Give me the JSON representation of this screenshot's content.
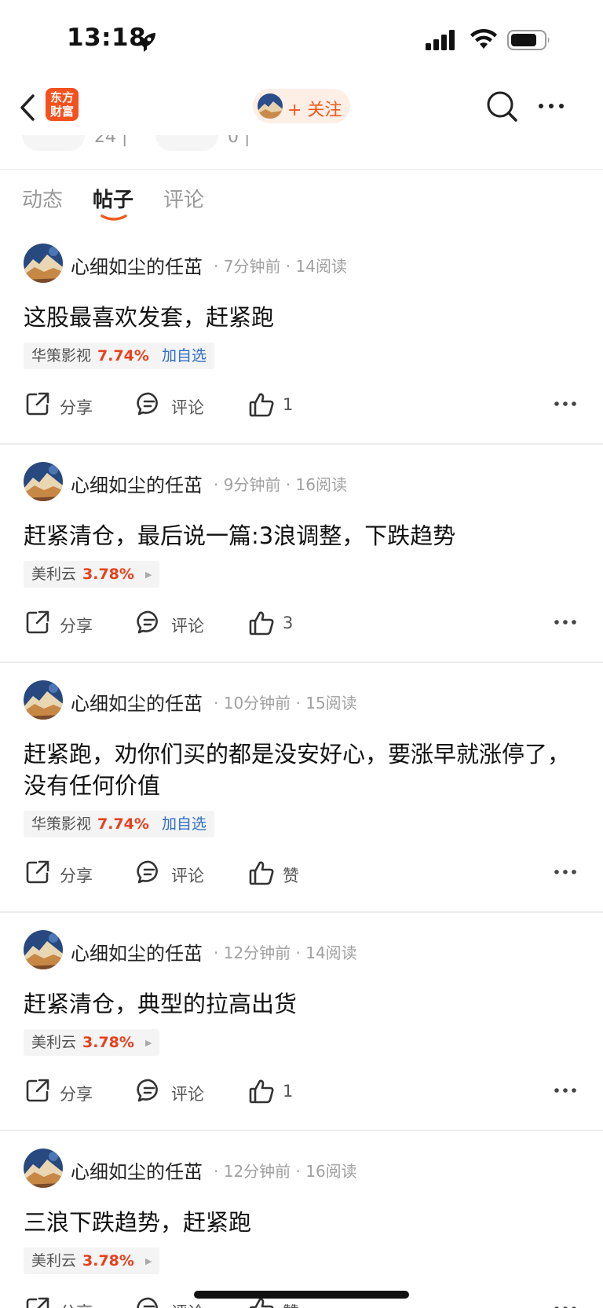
{
  "status_bar": {
    "time": "13:18"
  },
  "nav": {
    "app_logo_line1": "东方",
    "app_logo_line2": "财富",
    "follow_label": "+ 关注",
    "brand_color": "#f05a1e"
  },
  "stats_partial": {
    "left_value": "24 |",
    "right_value": "0 |"
  },
  "tabs": [
    {
      "label": "动态",
      "active": false
    },
    {
      "label": "帖子",
      "active": true
    },
    {
      "label": "评论",
      "active": false
    }
  ],
  "actions": {
    "share": "分享",
    "comment": "评论"
  },
  "posts": [
    {
      "author": "心细如尘的任茁",
      "meta": "· 7分钟前 · 14阅读",
      "text": "这股最喜欢发套，赶紧跑",
      "stock": {
        "name": "华策影视",
        "pct": "7.74%",
        "extra": "加自选"
      },
      "likes": "1"
    },
    {
      "author": "心细如尘的任茁",
      "meta": "· 9分钟前 · 16阅读",
      "text": "赶紧清仓，最后说一篇:3浪调整，下跌趋势",
      "stock": {
        "name": "美利云",
        "pct": "3.78%",
        "extra": ""
      },
      "likes": "3"
    },
    {
      "author": "心细如尘的任茁",
      "meta": "· 10分钟前 · 15阅读",
      "text": "赶紧跑，劝你们买的都是没安好心，要涨早就涨停了，没有任何价值",
      "stock": {
        "name": "华策影视",
        "pct": "7.74%",
        "extra": "加自选"
      },
      "likes": "赞"
    },
    {
      "author": "心细如尘的任茁",
      "meta": "· 12分钟前 · 14阅读",
      "text": "赶紧清仓，典型的拉高出货",
      "stock": {
        "name": "美利云",
        "pct": "3.78%",
        "extra": ""
      },
      "likes": "1"
    },
    {
      "author": "心细如尘的任茁",
      "meta": "· 12分钟前 · 16阅读",
      "text": "三浪下跌趋势，赶紧跑",
      "stock": {
        "name": "美利云",
        "pct": "3.78%",
        "extra": ""
      },
      "likes": "赞"
    }
  ]
}
